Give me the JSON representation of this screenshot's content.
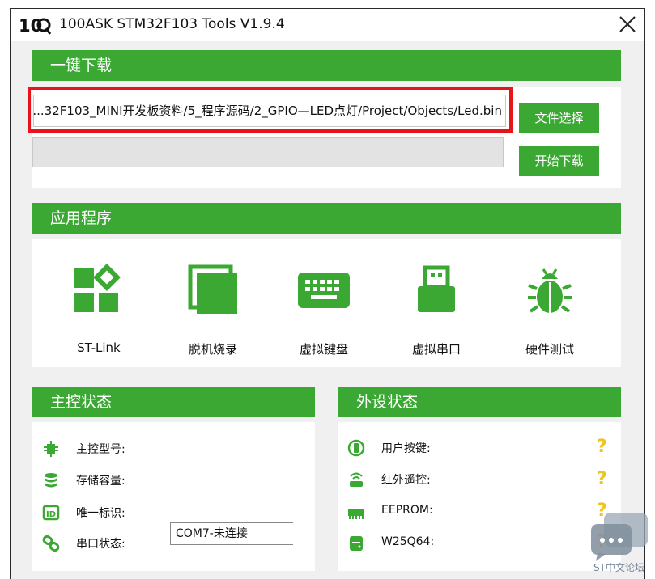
{
  "window": {
    "logo_text": "10Q",
    "title": "100ASK STM32F103 Tools V1.9.4"
  },
  "download": {
    "section_title": "一键下载",
    "file_path": "...32F103_MINI开发板资料/5_程序源码/2_GPIO—LED点灯/Project/Objects/Led.bin",
    "select_file_label": "文件选择",
    "start_download_label": "开始下载",
    "progress": 0
  },
  "apps": {
    "section_title": "应用程序",
    "items": [
      {
        "label": "ST-Link",
        "icon": "st-link-icon"
      },
      {
        "label": "脱机烧录",
        "icon": "offline-burn-icon"
      },
      {
        "label": "虚拟键盘",
        "icon": "keyboard-icon"
      },
      {
        "label": "虚拟串口",
        "icon": "usb-icon"
      },
      {
        "label": "硬件测试",
        "icon": "bug-icon"
      }
    ]
  },
  "master_status": {
    "section_title": "主控状态",
    "rows": [
      {
        "label": "主控型号:",
        "icon": "chip-icon"
      },
      {
        "label": "存储容量:",
        "icon": "database-icon"
      },
      {
        "label": "唯一标识:",
        "icon": "id-icon"
      },
      {
        "label": "串口状态:",
        "icon": "link-icon"
      }
    ],
    "com_status": "COM7-未连接"
  },
  "peripheral_status": {
    "section_title": "外设状态",
    "rows": [
      {
        "label": "用户按键:",
        "icon": "button-icon",
        "status": "?"
      },
      {
        "label": "红外遥控:",
        "icon": "infrared-icon",
        "status": "?"
      },
      {
        "label": "EEPROM:",
        "icon": "memory-icon",
        "status": "?"
      },
      {
        "label": "W25Q64:",
        "icon": "flash-icon",
        "status": "?"
      }
    ]
  },
  "watermark": {
    "text": "ST中文论坛"
  },
  "colors": {
    "accent_green": "#3aa832",
    "highlight_red": "#e8141c",
    "question_yellow": "#f0c419"
  }
}
